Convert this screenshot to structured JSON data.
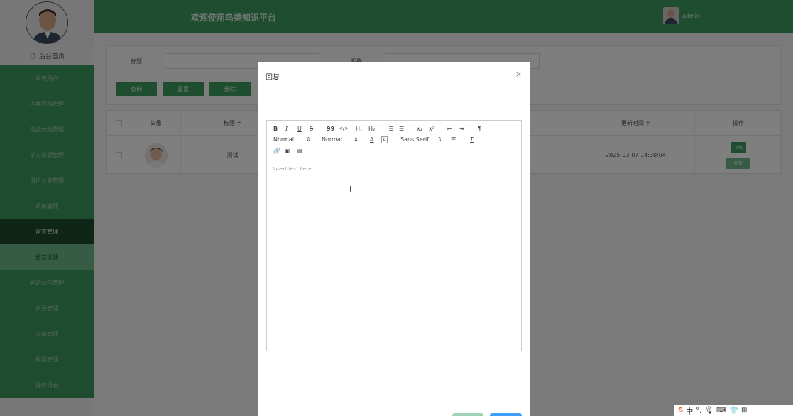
{
  "header": {
    "title": "欢迎使用鸟类知识平台",
    "username": "admin"
  },
  "sidebar": {
    "home_label": "后台首页",
    "items": [
      {
        "label": "系统用户"
      },
      {
        "label": "鸟类百科管理"
      },
      {
        "label": "鸟类分类管理"
      },
      {
        "label": "学习资源管理"
      },
      {
        "label": "用户分享管理"
      },
      {
        "label": "系统管理"
      },
      {
        "label": "留言管理"
      },
      {
        "label": "留言反馈"
      },
      {
        "label": "网站公告管理"
      },
      {
        "label": "资源管理"
      },
      {
        "label": "交流管理"
      },
      {
        "label": "权限管理"
      },
      {
        "label": "操作日志"
      }
    ]
  },
  "search": {
    "title_label": "标题",
    "second_label": "昵称",
    "query_button": "查询",
    "reset_button": "重置",
    "delete_button": "删除"
  },
  "table": {
    "headers": [
      "头像",
      "标题 ≑",
      "更新时间 ≑",
      "操作"
    ],
    "rows": [
      {
        "title": "测试",
        "updated": "2025-03-07 14:30:04",
        "action1": "详情",
        "action2": "回复"
      }
    ]
  },
  "modal": {
    "title": "回复",
    "close": "×",
    "editor_placeholder": "Insert text here ...",
    "toolbar": {
      "header_select": "Normal",
      "size_select": "Normal",
      "font_select": "Sans Serif"
    }
  },
  "colors": {
    "brand_green": "#3c9a5f",
    "dark_green": "#1f4a2d",
    "light_green": "#6fb88a"
  }
}
